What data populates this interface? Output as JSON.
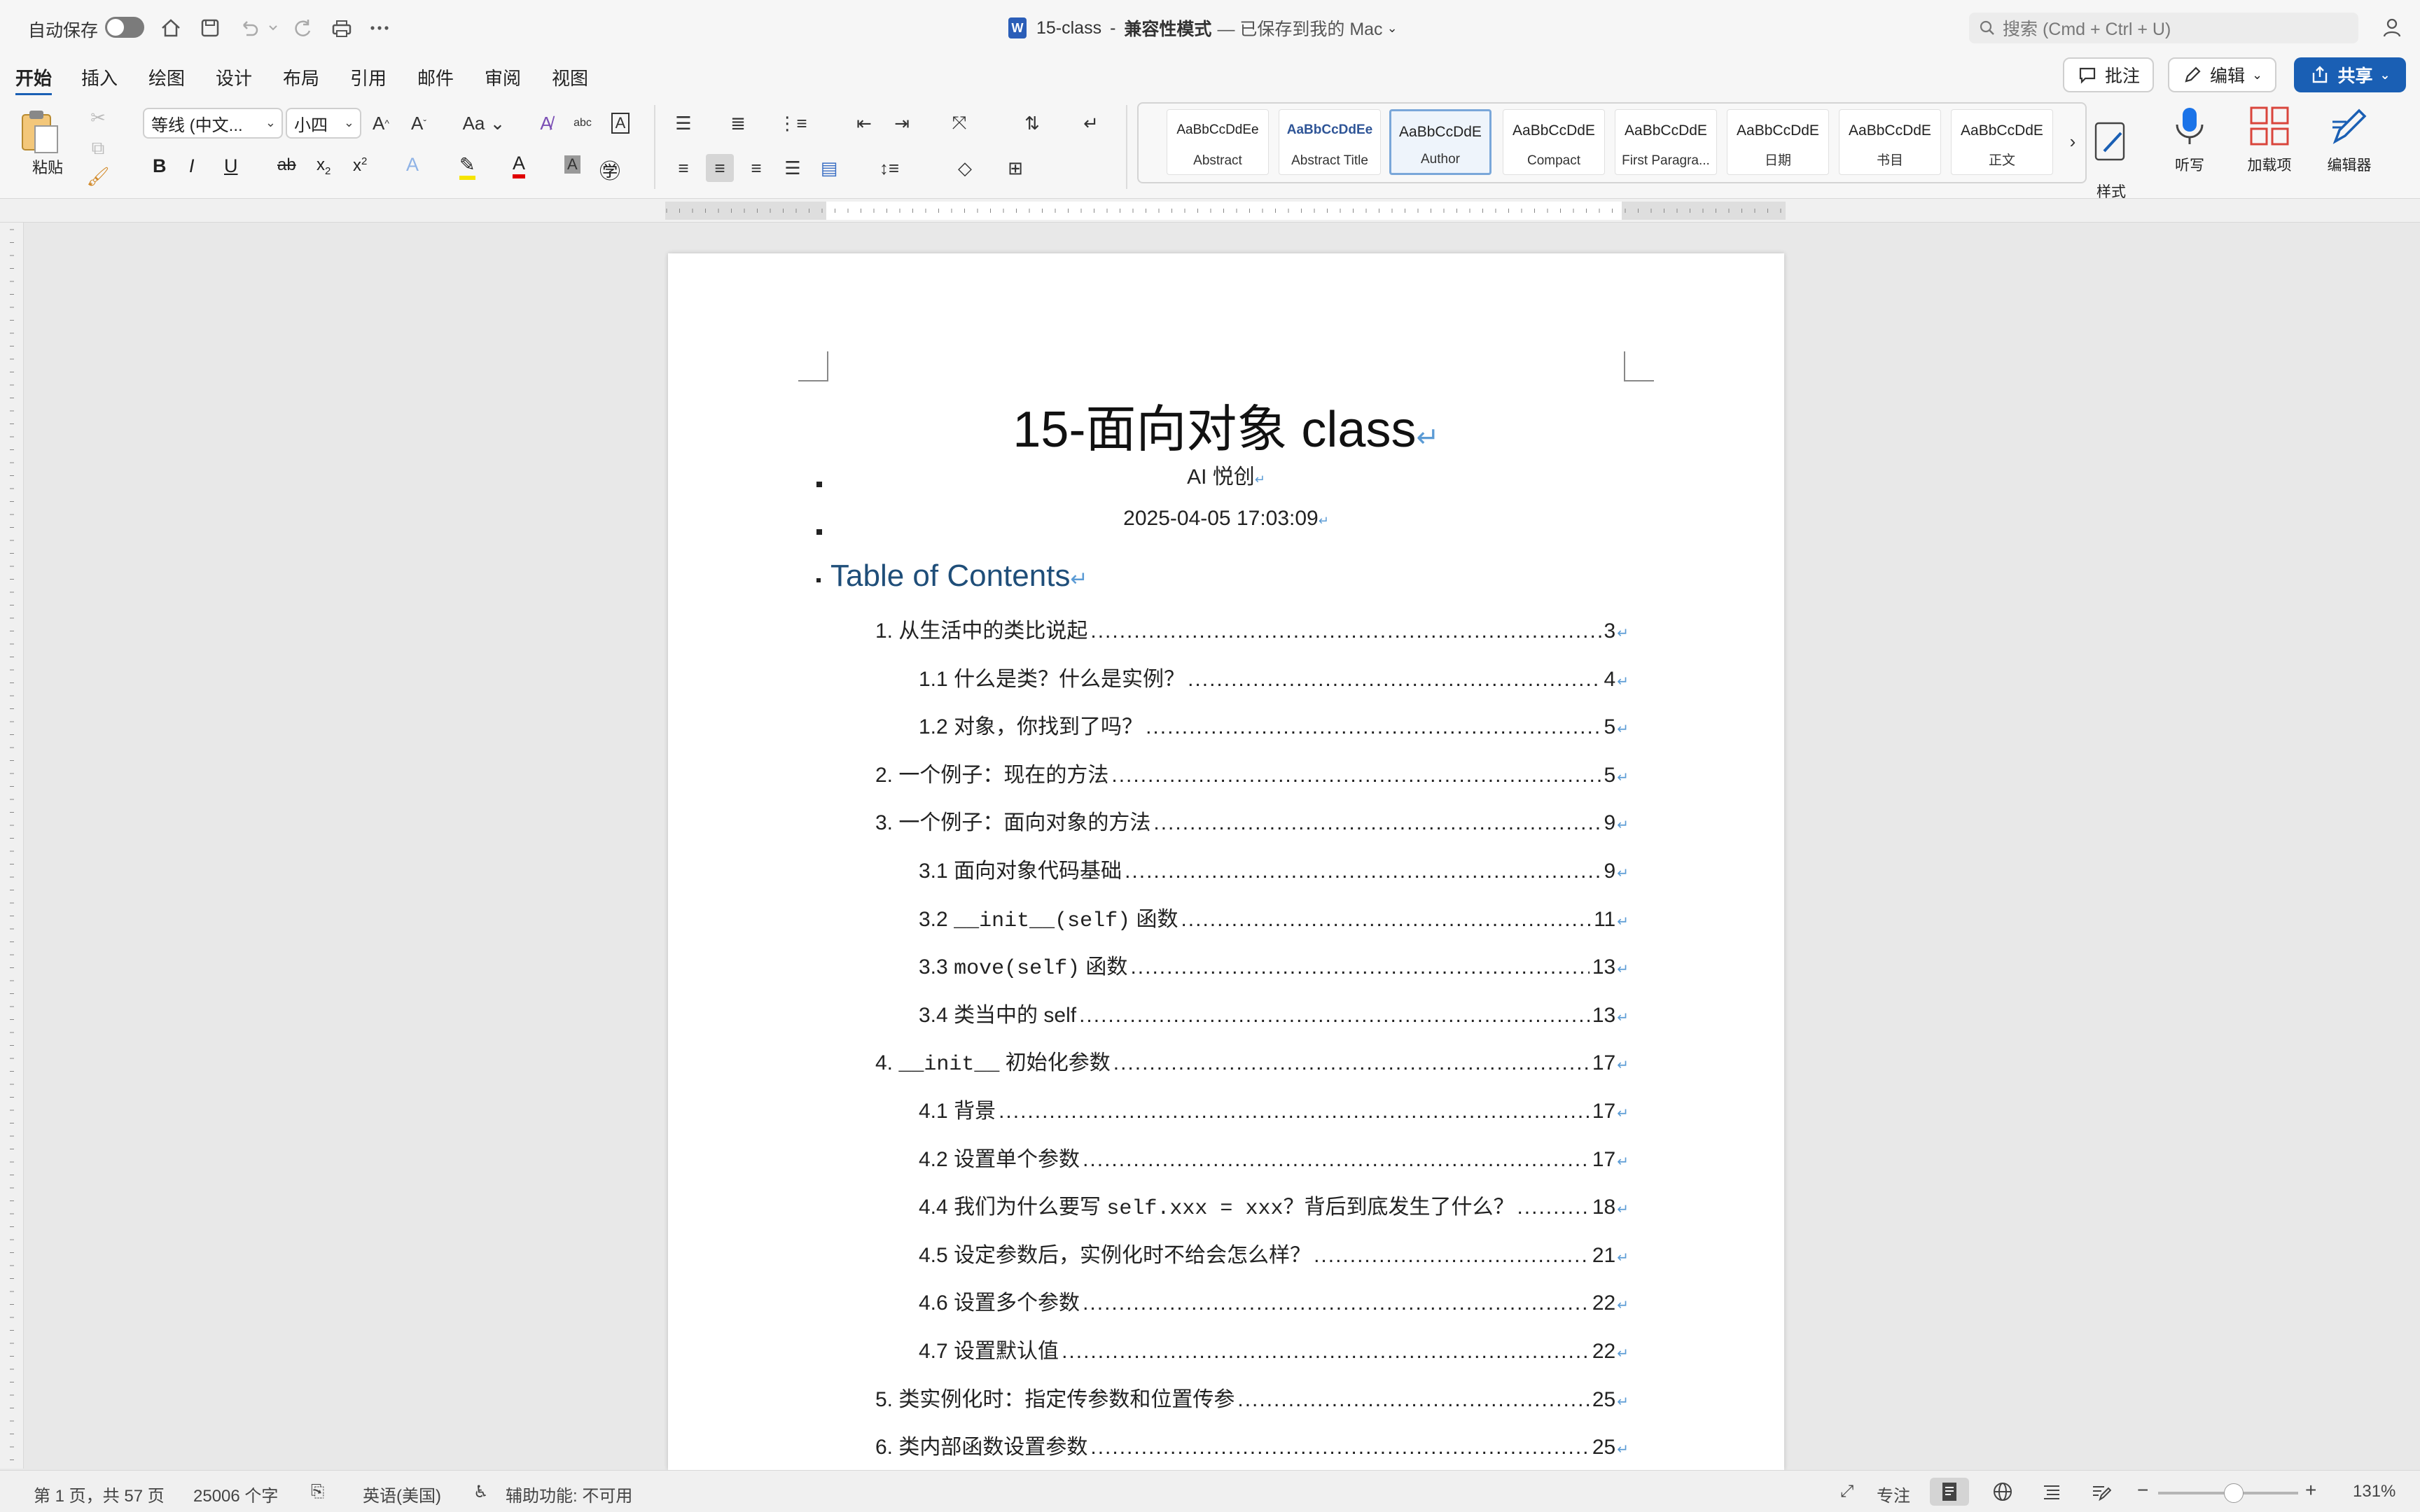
{
  "titlebar": {
    "autosave_label": "自动保存",
    "doc_name": "15-class",
    "separator": "-",
    "mode": "兼容性模式",
    "saved_status": "— 已保存到我的 Mac",
    "search_placeholder": "搜索 (Cmd + Ctrl + U)"
  },
  "tabs": [
    "开始",
    "插入",
    "绘图",
    "设计",
    "布局",
    "引用",
    "邮件",
    "审阅",
    "视图"
  ],
  "actions": {
    "comment": "批注",
    "edit": "编辑",
    "share": "共享"
  },
  "ribbon": {
    "paste": "粘贴",
    "font_name": "等线 (中文...",
    "font_size": "小四",
    "styles": [
      {
        "sample": "AaBbCcDdEe",
        "name": "Abstract"
      },
      {
        "sample": "AaBbCcDdEe",
        "name": "Abstract Title"
      },
      {
        "sample": "AaBbCcDdE",
        "name": "Author"
      },
      {
        "sample": "AaBbCcDdE",
        "name": "Compact"
      },
      {
        "sample": "AaBbCcDdE",
        "name": "First Paragra..."
      },
      {
        "sample": "AaBbCcDdE",
        "name": "日期"
      },
      {
        "sample": "AaBbCcDdE",
        "name": "书目"
      },
      {
        "sample": "AaBbCcDdE",
        "name": "正文"
      }
    ],
    "styles_pane": "样式\n窗格",
    "dictate": "听写",
    "addins": "加载项",
    "editor": "编辑器"
  },
  "document": {
    "title": "15-面向对象 class",
    "author": "AI 悦创",
    "date": "2025-04-05 17:03:09",
    "toc_heading": "Table of Contents",
    "toc": [
      {
        "num": "1.",
        "text": "从生活中的类比说起",
        "page": "3",
        "level": 1
      },
      {
        "num": "1.1",
        "text": "什么是类？什么是实例？",
        "page": "4",
        "level": 2
      },
      {
        "num": "1.2",
        "text": "对象，你找到了吗？",
        "page": "5",
        "level": 2
      },
      {
        "num": "2.",
        "text": "一个例子：现在的方法",
        "page": "5",
        "level": 1
      },
      {
        "num": "3.",
        "text": "一个例子：面向对象的方法",
        "page": "9",
        "level": 1
      },
      {
        "num": "3.1",
        "text": "面向对象代码基础",
        "page": "9",
        "level": 2
      },
      {
        "num": "3.2",
        "code": "__init__(self)",
        "text": " 函数",
        "page": "11",
        "level": 2
      },
      {
        "num": "3.3",
        "code": "move(self)",
        "text": " 函数",
        "page": "13",
        "level": 2
      },
      {
        "num": "3.4",
        "text": "类当中的 self",
        "page": "13",
        "level": 2
      },
      {
        "num": "4.",
        "code": "__init__",
        "text": " 初始化参数",
        "page": "17",
        "level": 1
      },
      {
        "num": "4.1",
        "text": "背景",
        "page": "17",
        "level": 2
      },
      {
        "num": "4.2",
        "text": "设置单个参数",
        "page": "17",
        "level": 2
      },
      {
        "num": "4.4",
        "text": "我们为什么要写 ",
        "code": "self.xxx = xxx",
        "text2": "？背后到底发生了什么？",
        "page": "18",
        "level": 2
      },
      {
        "num": "4.5",
        "text": "设定参数后，实例化时不给会怎么样？",
        "page": "21",
        "level": 2
      },
      {
        "num": "4.6",
        "text": "设置多个参数",
        "page": "22",
        "level": 2
      },
      {
        "num": "4.7",
        "text": "设置默认值",
        "page": "22",
        "level": 2
      },
      {
        "num": "5.",
        "text": "类实例化时：指定传参数和位置传参",
        "page": "25",
        "level": 1
      },
      {
        "num": "6.",
        "text": "类内部函数设置参数",
        "page": "25",
        "level": 1
      }
    ]
  },
  "status": {
    "page": "第 1 页，共 57 页",
    "words": "25006 个字",
    "language": "英语(美国)",
    "accessibility": "辅助功能: 不可用",
    "focus": "专注",
    "zoom": "131%"
  }
}
